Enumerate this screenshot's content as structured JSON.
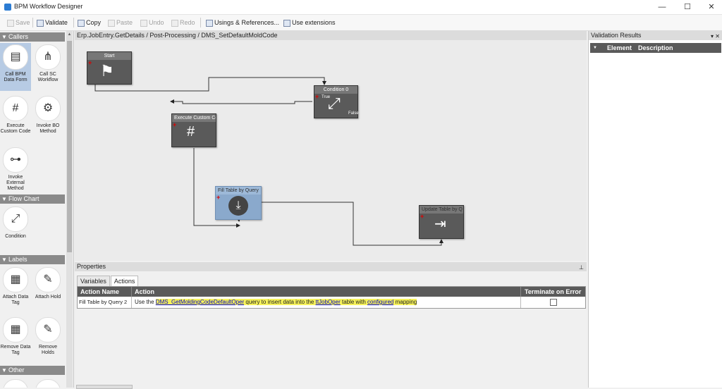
{
  "window": {
    "title": "BPM Workflow Designer",
    "minimize": "—",
    "maximize": "☐",
    "close": "✕"
  },
  "toolbar": {
    "save": "Save",
    "validate": "Validate",
    "copy": "Copy",
    "paste": "Paste",
    "undo": "Undo",
    "redo": "Redo",
    "usings": "Usings & References...",
    "extensions": "Use extensions"
  },
  "toolbox": {
    "callers": {
      "title": "Callers",
      "items": [
        {
          "label": "Call BPM Data Form",
          "icon": "data-form-icon"
        },
        {
          "label": "Call SC Workflow",
          "icon": "workflow-icon"
        },
        {
          "label": "Execute Custom Code",
          "icon": "code-icon"
        },
        {
          "label": "Invoke BO Method",
          "icon": "bo-method-icon"
        },
        {
          "label": "Invoke External Method",
          "icon": "external-method-icon"
        }
      ]
    },
    "flowchart": {
      "title": "Flow Chart",
      "items": [
        {
          "label": "Condition",
          "icon": "condition-icon"
        }
      ]
    },
    "labels": {
      "title": "Labels",
      "items": [
        {
          "label": "Attach Data Tag",
          "icon": "data-tag-icon"
        },
        {
          "label": "Attach Hold",
          "icon": "hold-icon"
        },
        {
          "label": "Remove Data Tag",
          "icon": "remove-data-tag-icon"
        },
        {
          "label": "Remove Holds",
          "icon": "remove-hold-icon"
        }
      ]
    },
    "other": {
      "title": "Other"
    }
  },
  "canvas": {
    "breadcrumb": "Erp.JobEntry.GetDetails / Post-Processing / DMS_SetDefaultMoldCode",
    "nodes": {
      "start": "Start",
      "condition": "Condition 0",
      "condition_true": "True",
      "condition_false": "False",
      "execute": "Execute Custom Co",
      "fill": "Fill Table by Query",
      "update": "Update Table by Q"
    }
  },
  "validation": {
    "title": "Validation Results",
    "col_element": "Element",
    "col_description": "Description"
  },
  "properties": {
    "title": "Properties",
    "tabs": [
      "Variables",
      "Actions"
    ],
    "columns": {
      "action_name": "Action Name",
      "action": "Action",
      "terminate": "Terminate on Error"
    },
    "rows": [
      {
        "name": "Fill Table by Query 2",
        "text1": "Use the ",
        "link1": "DMS_GetMoldingCodeDefaultOper",
        "text2": " query to insert data into the ",
        "link2": "ttJobOper",
        "text3": " table with ",
        "link3": "configured",
        "text4": " mapping",
        "terminate": false
      }
    ]
  },
  "colors": {
    "highlight": "#f6f25a",
    "node": "#5a5a5a",
    "selected_node": "#8aa9cc"
  }
}
